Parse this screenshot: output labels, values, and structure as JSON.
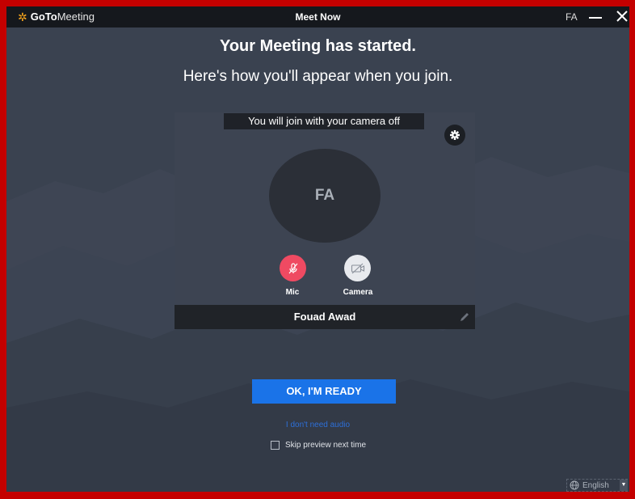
{
  "window": {
    "brand_goto": "GoTo",
    "brand_meeting": "Meeting",
    "title": "Meet Now",
    "user_initials": "FA"
  },
  "main": {
    "heading": "Your Meeting has started.",
    "subheading": "Here's how you'll appear when you join."
  },
  "preview": {
    "camera_notice": "You will join with your camera off",
    "avatar_initials": "FA",
    "mic_label": "Mic",
    "camera_label": "Camera",
    "participant_name": "Fouad Awad",
    "mic_state": "muted",
    "camera_state": "off"
  },
  "actions": {
    "ready_label": "OK, I'M READY",
    "no_audio_label": "I don't need audio",
    "skip_preview_label": "Skip preview next time",
    "skip_preview_checked": false
  },
  "footer": {
    "language": "English"
  },
  "icons": {
    "logo": "gotomeeting-logo-icon",
    "minimize": "minimize-icon",
    "close": "close-icon",
    "settings": "gear-icon",
    "mic": "mic-off-icon",
    "camera": "camera-off-icon",
    "edit": "pencil-icon",
    "globe": "globe-icon",
    "caret": "chevron-down-icon"
  },
  "colors": {
    "accent": "#1a73e8",
    "mic_muted": "#ef4a62",
    "brand_orange": "#f6a31b",
    "background": "#3a4250"
  }
}
